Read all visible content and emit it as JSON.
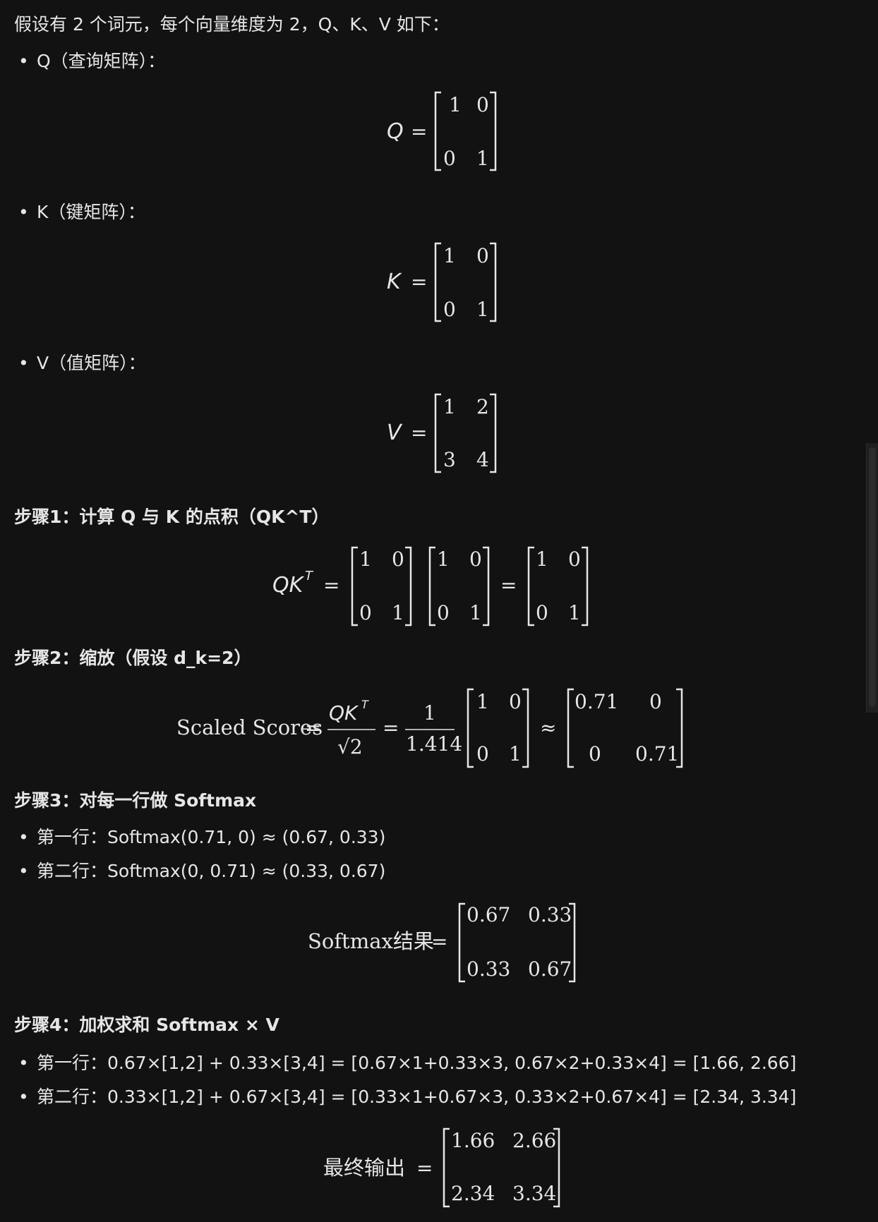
{
  "intro": "假设有 2 个词元，每个向量维度为 2，Q、K、V 如下：",
  "bullets": {
    "q": "Q（查询矩阵）：",
    "k": "K（键矩阵）：",
    "v": "V（值矩阵）："
  },
  "matrices": {
    "q": {
      "label": "Q",
      "rows": [
        [
          "1",
          "0"
        ],
        [
          "0",
          "1"
        ]
      ]
    },
    "k": {
      "label": "K",
      "rows": [
        [
          "1",
          "0"
        ],
        [
          "0",
          "1"
        ]
      ]
    },
    "v": {
      "label": "V",
      "rows": [
        [
          "1",
          "2"
        ],
        [
          "3",
          "4"
        ]
      ]
    }
  },
  "step1": {
    "title": "步骤1：计算 Q 与 K 的点积（QK^T）",
    "lhs": "QK",
    "sup": "T",
    "m1": [
      [
        "1",
        "0"
      ],
      [
        "0",
        "1"
      ]
    ],
    "m2": [
      [
        "1",
        "0"
      ],
      [
        "0",
        "1"
      ]
    ],
    "m3": [
      [
        "1",
        "0"
      ],
      [
        "0",
        "1"
      ]
    ]
  },
  "step2": {
    "title": "步骤2：缩放（假设 d_k=2）",
    "label": "Scaled Scores",
    "num": "QK",
    "sup": "T",
    "den": "√2",
    "frac_num": "1",
    "frac_den": "1.414",
    "m1": [
      [
        "1",
        "0"
      ],
      [
        "0",
        "1"
      ]
    ],
    "m2": [
      [
        "0.71",
        "0"
      ],
      [
        "0",
        "0.71"
      ]
    ]
  },
  "step3": {
    "title": "步骤3：对每一行做 Softmax",
    "row1": "第一行：Softmax(0.71, 0) ≈ (0.67, 0.33)",
    "row2": "第二行：Softmax(0, 0.71) ≈ (0.33, 0.67)",
    "label": "Softmax结果",
    "m": [
      [
        "0.67",
        "0.33"
      ],
      [
        "0.33",
        "0.67"
      ]
    ]
  },
  "step4": {
    "title": "步骤4：加权求和 Softmax × V",
    "row1": "第一行：0.67×[1,2] + 0.33×[3,4] = [0.67×1+0.33×3, 0.67×2+0.33×4] = [1.66, 2.66]",
    "row2": "第二行：0.33×[1,2] + 0.67×[3,4] = [0.33×1+0.67×3, 0.33×2+0.67×4] = [2.34, 3.34]",
    "label": "最终输出",
    "m": [
      [
        "1.66",
        "2.66"
      ],
      [
        "2.34",
        "3.34"
      ]
    ]
  },
  "symbols": {
    "eq": "=",
    "approx": "≈",
    "dot": "•"
  }
}
